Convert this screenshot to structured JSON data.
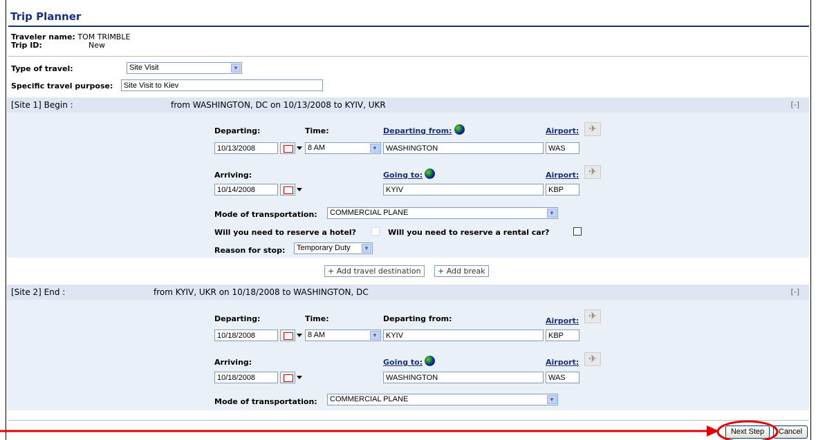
{
  "header": {
    "title": "Trip Planner"
  },
  "traveler": {
    "name_label": "Traveler name:",
    "name_value": "TOM TRIMBLE",
    "tripid_label": "Trip ID:",
    "tripid_value": "New"
  },
  "trip": {
    "type_label": "Type of travel:",
    "type_value": "Site Visit",
    "purpose_label": "Specific travel purpose:",
    "purpose_value": "Site Visit to Kiev"
  },
  "site1": {
    "band_label": "[Site 1]   Begin :",
    "summary": "from WASHINGTON, DC on 10/13/2008 to KYIV, UKR",
    "collapse": "[-]",
    "departing_label": "Departing:",
    "time_label": "Time:",
    "departing_from_label": "Departing from:",
    "airport_label": "Airport:",
    "depart_date": "10/13/2008",
    "depart_time": "8 AM",
    "depart_from": "WASHINGTON",
    "depart_airport": "WAS",
    "arriving_label": "Arriving:",
    "going_to_label": "Going to:",
    "arrive_date": "10/14/2008",
    "arrive_to": "KYIV",
    "arrive_airport": "KBP",
    "mode_label": "Mode of transportation:",
    "mode_value": "COMMERCIAL PLANE",
    "hotel_label": "Will you need to reserve a hotel?",
    "car_label": "Will you need to reserve a rental car?",
    "reason_label": "Reason for stop:",
    "reason_value": "Temporary Duty"
  },
  "actions": {
    "add_destination": "+ Add travel destination",
    "add_break": "+ Add break"
  },
  "site2": {
    "band_label": "[Site 2]   End :",
    "summary": "from KYIV, UKR on 10/18/2008 to WASHINGTON, DC",
    "collapse": "[-]",
    "departing_label": "Departing:",
    "time_label": "Time:",
    "departing_from_label": "Departing from:",
    "airport_label": "Airport:",
    "depart_date": "10/18/2008",
    "depart_time": "8 AM",
    "depart_from": "KYIV",
    "depart_airport": "KBP",
    "arriving_label": "Arriving:",
    "going_to_label": "Going to:",
    "arrive_date": "10/18/2008",
    "arrive_to": "WASHINGTON",
    "arrive_airport": "WAS",
    "mode_label": "Mode of transportation:",
    "mode_value": "COMMERCIAL PLANE"
  },
  "footer": {
    "next_step": "Next Step",
    "cancel": "Cancel"
  },
  "colors": {
    "title": "#1a2f7a",
    "band": "#dde6f2",
    "body": "#eaf0f8",
    "annotation": "#e00000"
  }
}
